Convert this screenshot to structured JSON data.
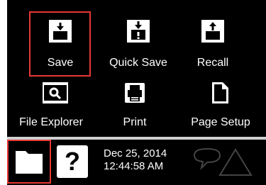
{
  "file_menu": {
    "items": [
      {
        "label": "Save",
        "icon": "save-icon",
        "selected": true
      },
      {
        "label": "Quick Save",
        "icon": "quick-save-icon"
      },
      {
        "label": "Recall",
        "icon": "recall-icon"
      },
      {
        "label": "File Explorer",
        "icon": "file-explorer-icon"
      },
      {
        "label": "Print",
        "icon": "print-icon"
      },
      {
        "label": "Page Setup",
        "icon": "page-setup-icon"
      }
    ]
  },
  "status_bar": {
    "help_glyph": "?",
    "date": "Dec 25, 2014",
    "time": "12:44:58 AM"
  },
  "colors": {
    "background": "#000000",
    "icon_fill": "#ffffff",
    "highlight": "#e53935"
  }
}
